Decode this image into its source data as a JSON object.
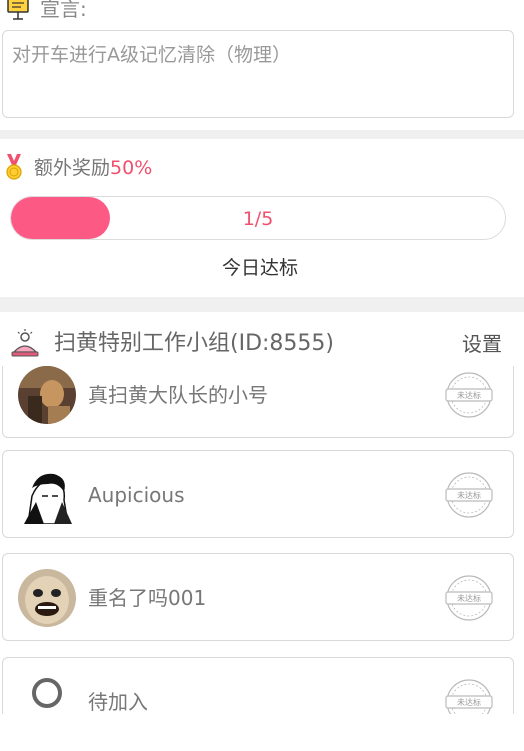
{
  "declaration": {
    "label": "宣言:",
    "text": "对开车进行A级记忆清除（物理）"
  },
  "bonus": {
    "label": "额外奖励",
    "percent": "50%",
    "progress_text": "1/5",
    "progress_fraction": 0.2,
    "today_label": "今日达标",
    "accent": "#fc5a85"
  },
  "group": {
    "title": "扫黄特别工作小组(ID:8555)",
    "settings_label": "设置"
  },
  "members": [
    {
      "name": "真扫黄大队长的小号",
      "avatar": "photo-avatar",
      "status": "未达标"
    },
    {
      "name": "Aupicious",
      "avatar": "manga-avatar",
      "status": "未达标"
    },
    {
      "name": "重名了吗001",
      "avatar": "meme-face-avatar",
      "status": "未达标"
    },
    {
      "name": "待加入",
      "avatar": "placeholder-user-icon",
      "status": "未达标"
    }
  ]
}
